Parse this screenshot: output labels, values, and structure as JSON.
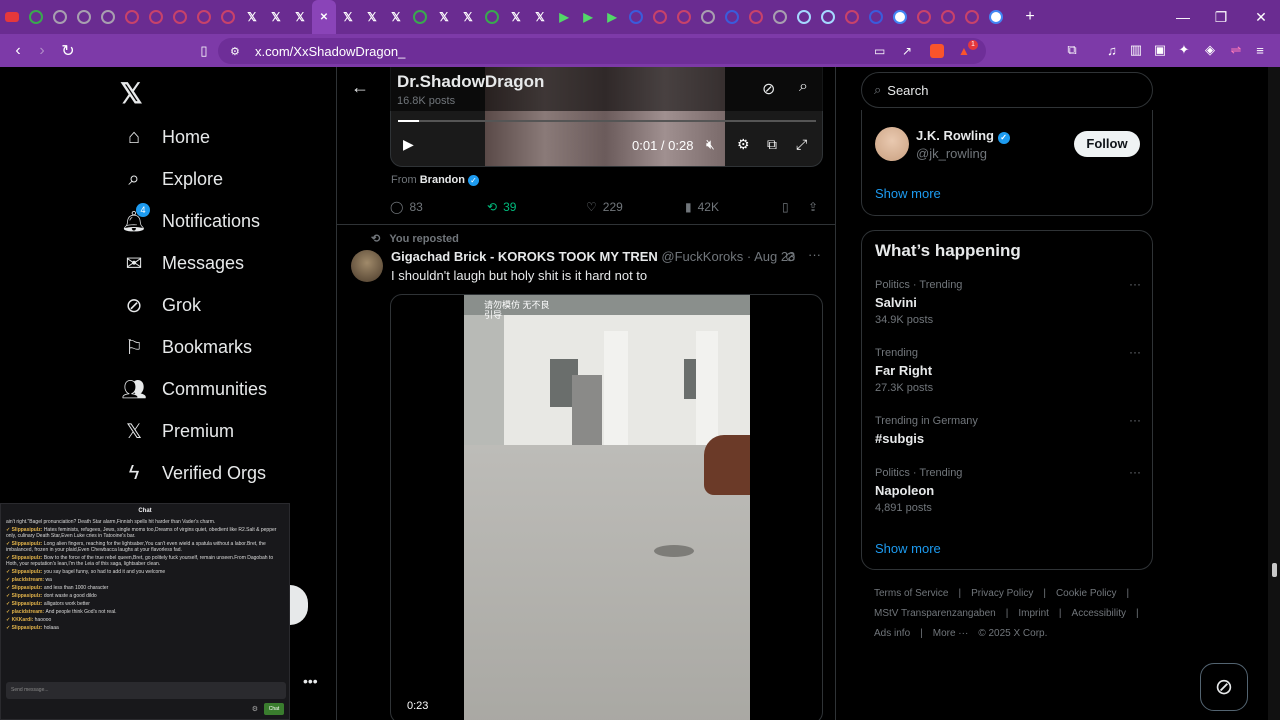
{
  "browser": {
    "tabs": [
      {
        "icon": "youtube-icon",
        "color": "#e5383b"
      },
      {
        "icon": "generic-icon",
        "color": "#3aa84f"
      },
      {
        "icon": "generic-icon",
        "color": "#a89fb0"
      },
      {
        "icon": "generic-icon",
        "color": "#a89fb0"
      },
      {
        "icon": "generic-icon",
        "color": "#a89fb0"
      },
      {
        "icon": "generic-icon",
        "color": "#c8426a"
      },
      {
        "icon": "generic-icon",
        "color": "#c8426a"
      },
      {
        "icon": "generic-icon",
        "color": "#c8426a"
      },
      {
        "icon": "generic-icon",
        "color": "#c8426a"
      },
      {
        "icon": "generic-icon",
        "color": "#c8426a"
      },
      {
        "icon": "x-icon",
        "color": "#ffffff"
      },
      {
        "icon": "x-icon",
        "color": "#ffffff"
      },
      {
        "icon": "x-icon",
        "color": "#ffffff"
      },
      {
        "icon": "close-icon",
        "color": "#ffffff"
      },
      {
        "icon": "x-icon",
        "color": "#ffffff"
      },
      {
        "icon": "x-icon",
        "color": "#ffffff"
      },
      {
        "icon": "x-icon",
        "color": "#ffffff"
      },
      {
        "icon": "generic-icon",
        "color": "#3aa84f"
      },
      {
        "icon": "x-icon",
        "color": "#ffffff"
      },
      {
        "icon": "x-icon",
        "color": "#ffffff"
      },
      {
        "icon": "generic-icon",
        "color": "#3aa84f"
      },
      {
        "icon": "x-icon",
        "color": "#ffffff"
      },
      {
        "icon": "x-icon",
        "color": "#ffffff"
      },
      {
        "icon": "play-icon",
        "color": "#53d769"
      },
      {
        "icon": "play-icon",
        "color": "#53d769"
      },
      {
        "icon": "play-icon",
        "color": "#53d769"
      },
      {
        "icon": "generic-icon",
        "color": "#3b5bdb"
      },
      {
        "icon": "generic-icon",
        "color": "#c8426a"
      },
      {
        "icon": "generic-icon",
        "color": "#c8426a"
      },
      {
        "icon": "generic-icon",
        "color": "#a89fb0"
      },
      {
        "icon": "generic-icon",
        "color": "#3b5bdb"
      },
      {
        "icon": "generic-icon",
        "color": "#c8426a"
      },
      {
        "icon": "generic-icon",
        "color": "#a89fb0"
      },
      {
        "icon": "generic-icon",
        "color": "#a5d8ff"
      },
      {
        "icon": "generic-icon",
        "color": "#a5d8ff"
      },
      {
        "icon": "generic-icon",
        "color": "#c8426a"
      },
      {
        "icon": "generic-icon",
        "color": "#3b5bdb"
      },
      {
        "icon": "google-icon",
        "color": "#ffffff"
      },
      {
        "icon": "generic-icon",
        "color": "#c8426a"
      },
      {
        "icon": "generic-icon",
        "color": "#c8426a"
      },
      {
        "icon": "generic-icon",
        "color": "#c8426a"
      },
      {
        "icon": "google-icon",
        "color": "#ffffff"
      }
    ],
    "new_tab": "+",
    "url": "x.com/XxShadowDragon_",
    "brave_badge": "1"
  },
  "nav": {
    "items": [
      {
        "label": "Home",
        "icon": "home-icon"
      },
      {
        "label": "Explore",
        "icon": "search-icon"
      },
      {
        "label": "Notifications",
        "icon": "bell-icon",
        "badge": "4"
      },
      {
        "label": "Messages",
        "icon": "mail-icon"
      },
      {
        "label": "Grok",
        "icon": "grok-icon"
      },
      {
        "label": "Bookmarks",
        "icon": "bookmark-icon"
      },
      {
        "label": "Communities",
        "icon": "communities-icon"
      },
      {
        "label": "Premium",
        "icon": "x-icon"
      },
      {
        "label": "Verified Orgs",
        "icon": "bolt-icon"
      }
    ]
  },
  "chat": {
    "title": "Chat",
    "messages": [
      {
        "user": "",
        "text": "ain't right.\"Bagel pronunciation? Death Star alarm,Finnish spells hit harder than Vader's charm."
      },
      {
        "user": "Slippasipulz:",
        "text": "Hates feminists, refugees, Jews, single moms too,Dreams of virgins quiet, obedient like R2.Salt & pepper only, culinary Death Star,Even Luke cries in Tatooine's bar."
      },
      {
        "user": "Slippasipulz:",
        "text": "Long alien fingers, reaching for the lightsaber,You can't even wield a spatula without a labor.Bret, the imbalanced, frozen in your plaid,Even Chewbacca laughs at your flavorless fad."
      },
      {
        "user": "Slippasipulz:",
        "text": "Bow to the force of the true rebel queen,Bret, go politely fuck yourself, remain unseen.From Dagobah to Hoth, your reputation's lean,I'm the Leia of this saga, lightsaber clean."
      },
      {
        "user": "Slippasipulz:",
        "text": "you say bagel funny, so had to add it and you welcome"
      },
      {
        "user": "placidstream:",
        "text": "wa"
      },
      {
        "user": "Slippasipulz:",
        "text": "and less than 1000 character"
      },
      {
        "user": "Slippasipulz:",
        "text": "dont waste a good dildo"
      },
      {
        "user": "Slippasipulz:",
        "text": "alligators work better"
      },
      {
        "user": "placidstream:",
        "text": "And people think God's not real."
      },
      {
        "user": "KKKardi:",
        "text": "haoooo"
      },
      {
        "user": "Slippasipulz:",
        "text": "holaaa"
      }
    ],
    "placeholder": "Send message...",
    "send": "Chat"
  },
  "main": {
    "header_title": "Dr.ShadowDragon",
    "header_sub": "16.8K posts",
    "video1": {
      "time": "0:01 / 0:28"
    },
    "from_label": "From",
    "from_name": "Brandon",
    "stats": {
      "replies": "83",
      "reposts": "39",
      "likes": "229",
      "views": "42K"
    },
    "repost_label": "You reposted",
    "post2": {
      "author": "Gigachad Brick - KOROKS TOOK MY TREN",
      "handle": "@FuckKoroks · Aug 23",
      "text": "I shouldn't laugh but holy shit is it hard not to",
      "video_time": "0:23",
      "overlay_text": "请勿模仿 无不良引导"
    }
  },
  "right": {
    "search_placeholder": "Search",
    "follow": {
      "name": "J.K. Rowling",
      "handle": "@jk_rowling",
      "button": "Follow"
    },
    "show_more": "Show more",
    "happening_title": "What’s happening",
    "trends": [
      {
        "cat": "Politics · Trending",
        "name": "Salvini",
        "count": "34.9K posts"
      },
      {
        "cat": "Trending",
        "name": "Far Right",
        "count": "27.3K posts"
      },
      {
        "cat": "Trending in Germany",
        "name": "#subgis",
        "count": ""
      },
      {
        "cat": "Politics · Trending",
        "name": "Napoleon",
        "count": "4,891 posts"
      }
    ],
    "show_more2": "Show more",
    "footer": {
      "l1": [
        "Terms of Service",
        "|",
        "Privacy Policy",
        "|",
        "Cookie Policy",
        "|"
      ],
      "l2": [
        "MStV Transparenzangaben",
        "|",
        "Imprint",
        "|",
        "Accessibility",
        "|"
      ],
      "l3": [
        "Ads info",
        "|",
        "More ···",
        "© 2025 X Corp."
      ]
    }
  },
  "colors": {
    "accent": "#1d9bf0",
    "repost": "#00ba7c",
    "tabbar": "#6a2c91"
  }
}
